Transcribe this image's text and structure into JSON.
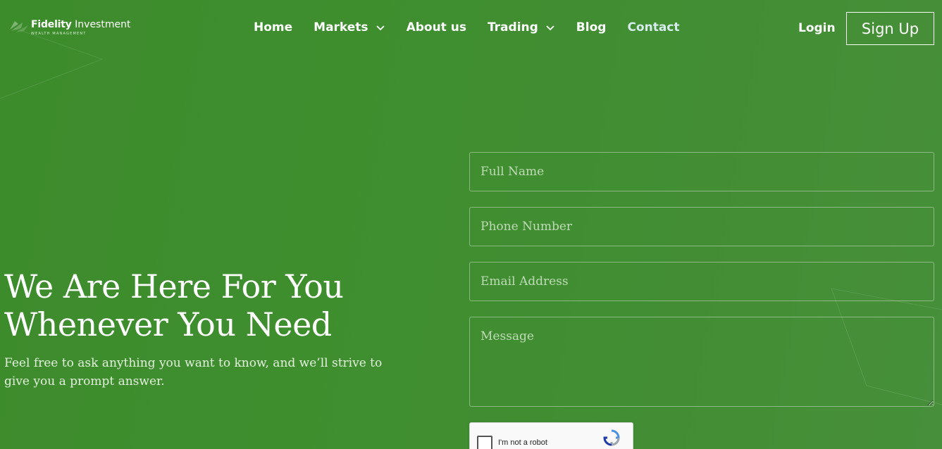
{
  "logo": {
    "name_bold": "Fidelity",
    "name_light": "Investment",
    "tagline": "WEALTH MANAGEMENT"
  },
  "nav": {
    "items": [
      {
        "label": "Home",
        "dropdown": false
      },
      {
        "label": "Markets",
        "dropdown": true
      },
      {
        "label": "About us",
        "dropdown": false
      },
      {
        "label": "Trading",
        "dropdown": true
      },
      {
        "label": "Blog",
        "dropdown": false
      },
      {
        "label": "Contact",
        "dropdown": false,
        "active": true
      }
    ],
    "login": "Login",
    "signup": "Sign Up"
  },
  "hero": {
    "title_line1": "We Are Here For You",
    "title_line2": "Whenever You Need",
    "subtitle": "Feel free to ask anything you want to know, and we’ll strive to give you a prompt answer."
  },
  "form": {
    "full_name": {
      "value": "",
      "placeholder": "Full Name"
    },
    "phone": {
      "value": "",
      "placeholder": "Phone Number"
    },
    "email": {
      "value": "",
      "placeholder": "Email Address"
    },
    "message": {
      "value": "",
      "placeholder": "Message"
    }
  },
  "captcha": {
    "label": "I'm not a robot",
    "icon": "recaptcha-icon"
  },
  "colors": {
    "background": "#3f8e2f",
    "active_nav": "#d8ecef",
    "text": "#ffffff"
  }
}
